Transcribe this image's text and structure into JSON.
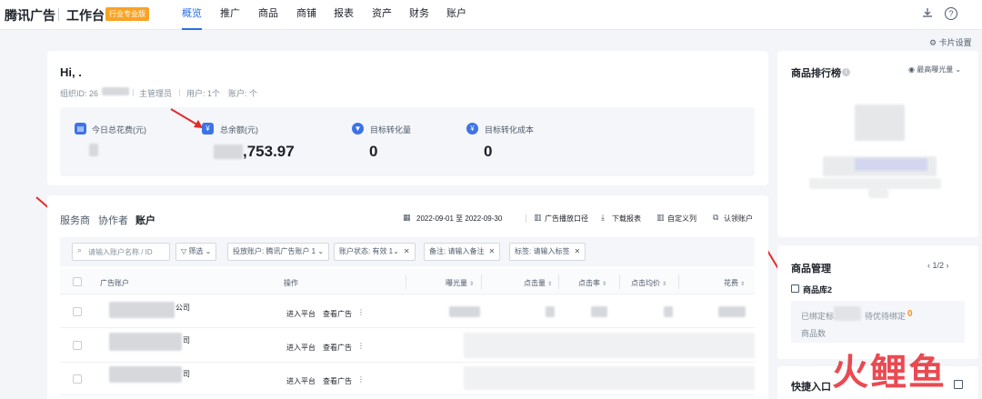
{
  "header": {
    "brand": "腾讯广告",
    "workbench": "工作台",
    "edition_badge": "行业专业版",
    "nav": [
      "概览",
      "推广",
      "商品",
      "商铺",
      "报表",
      "资产",
      "财务",
      "账户"
    ],
    "active_nav": "概览",
    "icons": [
      "download-icon",
      "help-icon"
    ]
  },
  "card_settings": "卡片设置",
  "welcome": {
    "greeting": "Hi, .",
    "org_id_label": "组织ID: 26",
    "role": "主管理员",
    "users": "用户: 1个",
    "accounts": "账户:   个"
  },
  "stats": [
    {
      "label": "今日总花费(元)",
      "value": "",
      "icon": "wallet-icon"
    },
    {
      "label": "总余额(元)",
      "value": ",753.97",
      "icon": "yuan-icon"
    },
    {
      "label": "目标转化量",
      "value": "0",
      "icon": "funnel-icon"
    },
    {
      "label": "目标转化成本",
      "value": "0",
      "icon": "yuan-icon"
    }
  ],
  "tabs": [
    "服务商",
    "协作者",
    "账户"
  ],
  "active_tab": "账户",
  "toolbar": {
    "date_range": "2022-09-01 至 2022-09-30",
    "ad_caliber": "广告播放口径",
    "download": "下载报表",
    "customize_columns": "自定义列",
    "claim_account": "认领账户"
  },
  "filters": {
    "search_placeholder": "请输入账户名称 / ID",
    "filter": "筛选",
    "chips": [
      "投放账户: 腾讯广告账户 1",
      "账户状态: 有效 1",
      "备注: 请输入备注",
      "标签: 请输入标签"
    ]
  },
  "table": {
    "columns": [
      "广告账户",
      "操作",
      "曝光量",
      "点击量",
      "点击率",
      "点击均价",
      "花费"
    ],
    "rows": [
      {
        "account_suffix": "公司",
        "actions": [
          "进入平台",
          "查看广告"
        ]
      },
      {
        "account_suffix": "司",
        "actions": [
          "进入平台",
          "查看广告"
        ]
      },
      {
        "account_suffix": "司",
        "actions": [
          "进入平台",
          "查看广告"
        ]
      }
    ]
  },
  "product_ranking": {
    "title": "商品排行榜",
    "sort_by": "最高曝光量"
  },
  "product_management": {
    "title": "商品管理",
    "page": "1/2",
    "library_name": "商品库2",
    "bound_label": "已绑定标",
    "pending_label": "待优待绑定",
    "pending_count": "0",
    "product_count_label": "商品数"
  },
  "shortcuts": {
    "title": "快捷入口"
  },
  "watermark": "火鲤鱼",
  "colors": {
    "primary": "#2d6ee8",
    "badge": "#f7a325",
    "arrow": "#e52a2a",
    "pending_count": "#f7931e"
  }
}
